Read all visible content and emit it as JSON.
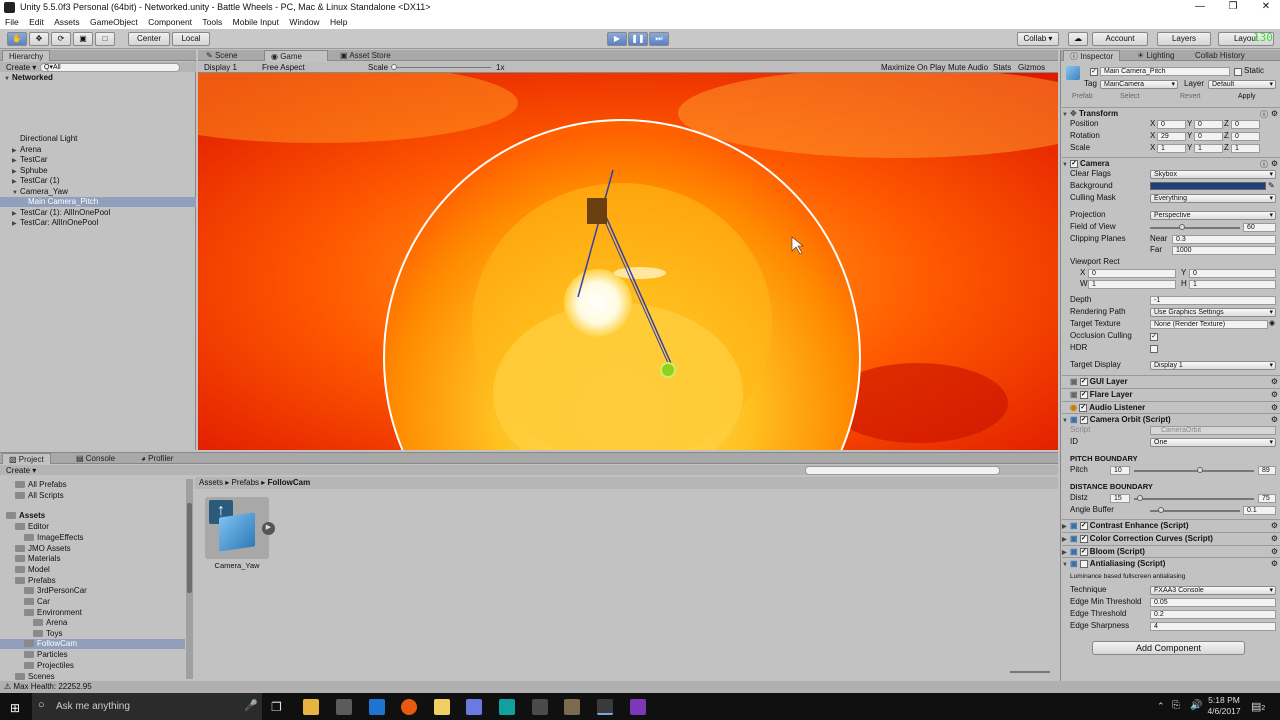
{
  "window": {
    "title": "Unity 5.5.0f3 Personal (64bit) - Networked.unity - Battle Wheels - PC, Mac & Linux Standalone <DX11>",
    "minimize": "—",
    "maximize": "❐",
    "close": "✕"
  },
  "menu": [
    "File",
    "Edit",
    "Assets",
    "GameObject",
    "Component",
    "Tools",
    "Mobile Input",
    "Window",
    "Help"
  ],
  "toolbar": {
    "pivot": "Center",
    "space": "Local",
    "collab": "Collab ▾",
    "account": "Account",
    "layers": "Layers",
    "layout": "Layout",
    "fps": "130",
    "fps2": "60"
  },
  "hierarchy": {
    "tab": "Hierarchy",
    "create": "Create ▾",
    "search": "Q▾All",
    "scene": "Networked",
    "items": [
      {
        "label": "Directional Light",
        "depth": 1,
        "arrow": ""
      },
      {
        "label": "Arena",
        "depth": 1,
        "arrow": "▶"
      },
      {
        "label": "TestCar",
        "depth": 1,
        "arrow": "▶"
      },
      {
        "label": "Sphube",
        "depth": 1,
        "arrow": "▶"
      },
      {
        "label": "TestCar (1)",
        "depth": 1,
        "arrow": "▶"
      },
      {
        "label": "Camera_Yaw",
        "depth": 1,
        "arrow": "▼"
      },
      {
        "label": "Main Camera_Pitch",
        "depth": 2,
        "arrow": "",
        "selected": true
      },
      {
        "label": "TestCar (1): AllInOnePool",
        "depth": 1,
        "arrow": "▶"
      },
      {
        "label": "TestCar: AllInOnePool",
        "depth": 1,
        "arrow": "▶"
      }
    ]
  },
  "game": {
    "tabs": [
      "Scene",
      "Game",
      "Asset Store"
    ],
    "display": "Display 1",
    "aspect": "Free Aspect",
    "scale_label": "Scale",
    "scale_value": "1x",
    "buttons": [
      "Maximize On Play",
      "Mute Audio",
      "Stats",
      "Gizmos"
    ]
  },
  "project": {
    "tabs": [
      "Project",
      "Console",
      "Profiler"
    ],
    "create": "Create ▾",
    "breadcrumb": [
      "Assets",
      "Prefabs",
      "FollowCam"
    ],
    "asset": "Camera_Yaw",
    "tree": [
      {
        "label": "All Prefabs",
        "depth": 1
      },
      {
        "label": "All Scripts",
        "depth": 1
      },
      {
        "label": "Assets",
        "depth": 0,
        "bold": true
      },
      {
        "label": "Editor",
        "depth": 1
      },
      {
        "label": "ImageEffects",
        "depth": 2
      },
      {
        "label": "JMO Assets",
        "depth": 1
      },
      {
        "label": "Materials",
        "depth": 1
      },
      {
        "label": "Model",
        "depth": 1
      },
      {
        "label": "Prefabs",
        "depth": 1
      },
      {
        "label": "3rdPersonCar",
        "depth": 2
      },
      {
        "label": "Car",
        "depth": 2
      },
      {
        "label": "Environment",
        "depth": 2
      },
      {
        "label": "Arena",
        "depth": 3
      },
      {
        "label": "Toys",
        "depth": 3
      },
      {
        "label": "FollowCam",
        "depth": 2,
        "selected": true
      },
      {
        "label": "Particles",
        "depth": 2
      },
      {
        "label": "Projectiles",
        "depth": 2
      },
      {
        "label": "Scenes",
        "depth": 1
      }
    ]
  },
  "status": {
    "text": "Max Health: 22252.95"
  },
  "inspector": {
    "tabs": [
      "Inspector",
      "Lighting",
      "Collab History"
    ],
    "name": "Main Camera_Pitch",
    "static": "Static",
    "tag_label": "Tag",
    "tag": "MainCamera",
    "layer_label": "Layer",
    "layer": "Default",
    "prefab": "Prefab",
    "select": "Select",
    "revert": "Revert",
    "apply": "Apply",
    "transform": {
      "header": "Transform",
      "position": {
        "label": "Position",
        "x": "0",
        "y": "0",
        "z": "0"
      },
      "rotation": {
        "label": "Rotation",
        "x": "29",
        "y": "0",
        "z": "0"
      },
      "scale": {
        "label": "Scale",
        "x": "1",
        "y": "1",
        "z": "1"
      }
    },
    "camera": {
      "header": "Camera",
      "clear_flags": [
        "Clear Flags",
        "Skybox"
      ],
      "background": "Background",
      "background_color": "#1e3f7a",
      "culling": [
        "Culling Mask",
        "Everything"
      ],
      "projection": [
        "Projection",
        "Perspective"
      ],
      "fov": {
        "label": "Field of View",
        "value": "60",
        "slider": 0.35
      },
      "clipping": "Clipping Planes",
      "near": [
        "Near",
        "0.3"
      ],
      "far": [
        "Far",
        "1000"
      ],
      "viewport": "Viewport Rect",
      "vx": "0",
      "vy": "0",
      "vw": "1",
      "vh": "1",
      "depth": [
        "Depth",
        "-1"
      ],
      "rendering": [
        "Rendering Path",
        "Use Graphics Settings"
      ],
      "target_texture": [
        "Target Texture",
        "None (Render Texture)"
      ],
      "occlusion": "Occlusion Culling",
      "hdr": "HDR",
      "target_display": [
        "Target Display",
        "Display 1"
      ]
    },
    "components": [
      "GUI Layer",
      "Flare Layer",
      "Audio Listener"
    ],
    "orbit": {
      "header": "Camera Orbit (Script)",
      "script_label": "Script",
      "script": "CameraOrbit",
      "id_label": "ID",
      "id": "One",
      "pitch_boundary": "PITCH BOUNDARY",
      "pitch": [
        "Pitch",
        "10",
        "89"
      ],
      "distance_boundary": "DISTANCE BOUNDARY",
      "dist": [
        "Distz",
        "15",
        "75"
      ],
      "angle": [
        "Angle Buffer",
        "0.1"
      ]
    },
    "scripts": [
      "Contrast Enhance (Script)",
      "Color Correction Curves (Script)",
      "Bloom (Script)"
    ],
    "aa": {
      "header": "Antialiasing (Script)",
      "desc": "Luminance based fullscreen antialiasing",
      "technique": [
        "Technique",
        "FXAA3 Console"
      ],
      "edge_min": [
        "Edge Min Threshold",
        "0.05"
      ],
      "edge_thr": [
        "Edge Threshold",
        "0.2"
      ],
      "edge_sharp": [
        "Edge Sharpness",
        "4"
      ]
    },
    "add_component": "Add Component"
  },
  "taskbar": {
    "search": "Ask me anything",
    "time": "5:18 PM",
    "date": "4/6/2017",
    "notif": "2"
  }
}
